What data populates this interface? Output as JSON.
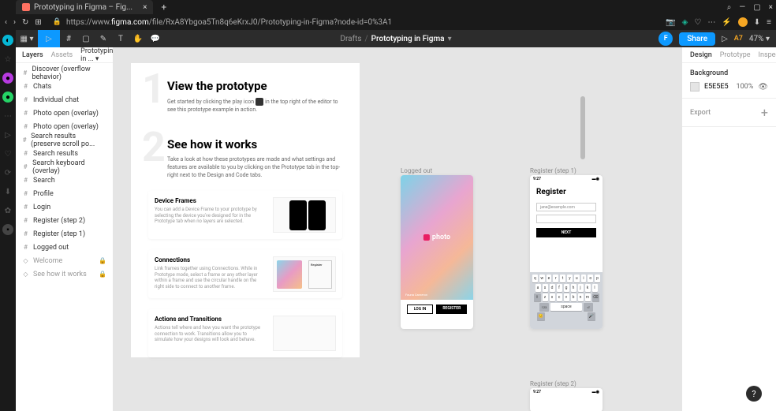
{
  "browser": {
    "tab_title": "Prototyping in Figma – Fig...",
    "url_prefix": "https://www.",
    "url_domain": "figma.com",
    "url_path": "/file/RxA8Ybgoa5Tn8q6eKrxJ0/Prototyping-in-Figma?node-id=0%3A1"
  },
  "figma": {
    "drafts": "Drafts",
    "file_name": "Prototyping in Figma",
    "avatar": "F",
    "share": "Share",
    "a7": "A7",
    "zoom": "47%"
  },
  "left_panel": {
    "tabs": {
      "layers": "Layers",
      "assets": "Assets"
    },
    "page": "Prototyping in ...",
    "layers": [
      "Discover (overflow behavior)",
      "Chats",
      "Individual chat",
      "Photo open (overlay)",
      "Photo open (overlay)",
      "Search results (preserve scroll po...",
      "Search results",
      "Search keyboard (overlay)",
      "Search",
      "Profile",
      "Login",
      "Register (step 2)",
      "Register (step 1)",
      "Logged out"
    ],
    "components": [
      "Welcome",
      "See how it works"
    ]
  },
  "canvas": {
    "sec1": {
      "num": "1",
      "title": "View the prototype",
      "body_a": "Get started by clicking the play icon",
      "body_b": "in the top right of the editor to see this prototype example in action."
    },
    "sec2": {
      "num": "2",
      "title": "See how it works",
      "body": "Take a look at how these prototypes are made and what settings and features are available to you by clicking on the Prototype tab in the top-right next to the Design and Code tabs."
    },
    "card1": {
      "title": "Device Frames",
      "body": "You can add a Device Frame to your prototype by selecting the device you've designed for in the Prototype tab when no layers are selected."
    },
    "card2": {
      "title": "Connections",
      "body": "Link frames together using Connections. While in Prototype mode, select a frame or any other layer within a frame and use the circular handle on the right side to connect to another frame."
    },
    "card3": {
      "title": "Actions and Transitions",
      "body": "Actions tell where and how you want the prototype connection to work. Transitions allow you to simulate how your designs will look and behave."
    },
    "logged_out": {
      "label": "Logged out",
      "logo": "photo",
      "fauna": "Fauna Cameron",
      "login": "LOG IN",
      "register": "REGISTER"
    },
    "register1": {
      "label": "Register (step 1)",
      "time": "9:27",
      "title": "Register",
      "email": "jane@example.com",
      "next": "NEXT",
      "space": "space"
    },
    "register2": {
      "label": "Register (step 2)",
      "time": "9:27"
    }
  },
  "right_panel": {
    "tabs": {
      "design": "Design",
      "prototype": "Prototype",
      "inspect": "Inspect"
    },
    "background": "Background",
    "bg_color": "E5E5E5",
    "bg_opacity": "100%",
    "export": "Export"
  },
  "keyboard": {
    "row1": [
      "q",
      "w",
      "e",
      "r",
      "t",
      "y",
      "u",
      "i",
      "o",
      "p"
    ],
    "row2": [
      "a",
      "s",
      "d",
      "f",
      "g",
      "h",
      "j",
      "k",
      "l"
    ],
    "row3": [
      "z",
      "x",
      "c",
      "v",
      "b",
      "n",
      "m"
    ]
  }
}
